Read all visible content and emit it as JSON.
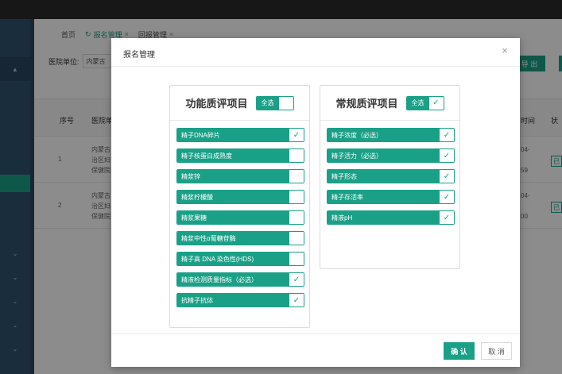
{
  "tabs": [
    {
      "label": "首页"
    },
    {
      "label": "报名管理",
      "close": "×"
    },
    {
      "label": "回报管理",
      "close": "×"
    }
  ],
  "filter": {
    "label": "医院单位:",
    "value": "内蒙古"
  },
  "toolbar": {
    "export_label": "导 出"
  },
  "table": {
    "headers": [
      "序号",
      "医院单",
      "时间",
      "状"
    ],
    "rows": [
      {
        "index": "1",
        "hospital": [
          "内蒙古",
          "治区妇",
          "保健院"
        ],
        "time": [
          "04-",
          "",
          "59"
        ],
        "status": "已"
      },
      {
        "index": "2",
        "hospital": [
          "内蒙古",
          "治区妇",
          "保健院"
        ],
        "time": [
          "04-",
          "",
          "00"
        ],
        "status": "已"
      }
    ]
  },
  "modal": {
    "title": "报名管理",
    "close": "×",
    "confirm_label": "确 认",
    "cancel_label": "取 消",
    "panels": [
      {
        "title": "功能质评项目",
        "select_all_label": "全选",
        "select_all_checked": false,
        "items": [
          {
            "label": "精子DNA碎片",
            "checked": true
          },
          {
            "label": "精子核蛋白成熟度",
            "checked": false
          },
          {
            "label": "精浆锌",
            "checked": false
          },
          {
            "label": "精浆柠檬酸",
            "checked": false
          },
          {
            "label": "精浆果糖",
            "checked": false
          },
          {
            "label": "精浆中性α葡糖苷酶",
            "checked": false
          },
          {
            "label": "精子高 DNA 染色性(HDS)",
            "checked": false
          },
          {
            "label": "精液检测质量指标（必选）",
            "checked": true
          },
          {
            "label": "抗精子抗体",
            "checked": true
          }
        ]
      },
      {
        "title": "常规质评项目",
        "select_all_label": "全选",
        "select_all_checked": true,
        "items": [
          {
            "label": "精子浓度（必选）",
            "checked": true
          },
          {
            "label": "精子活力（必选）",
            "checked": true
          },
          {
            "label": "精子形态",
            "checked": true
          },
          {
            "label": "精子存活率",
            "checked": true
          },
          {
            "label": "精液pH",
            "checked": true
          }
        ]
      }
    ]
  },
  "colors": {
    "accent": "#1aa087",
    "sidebar": "#305270",
    "topbar": "#2b2b2b"
  },
  "icons": {
    "check": "check-icon",
    "close": "close-icon",
    "refresh": "refresh-icon",
    "chevron": "chevron-down-icon"
  }
}
